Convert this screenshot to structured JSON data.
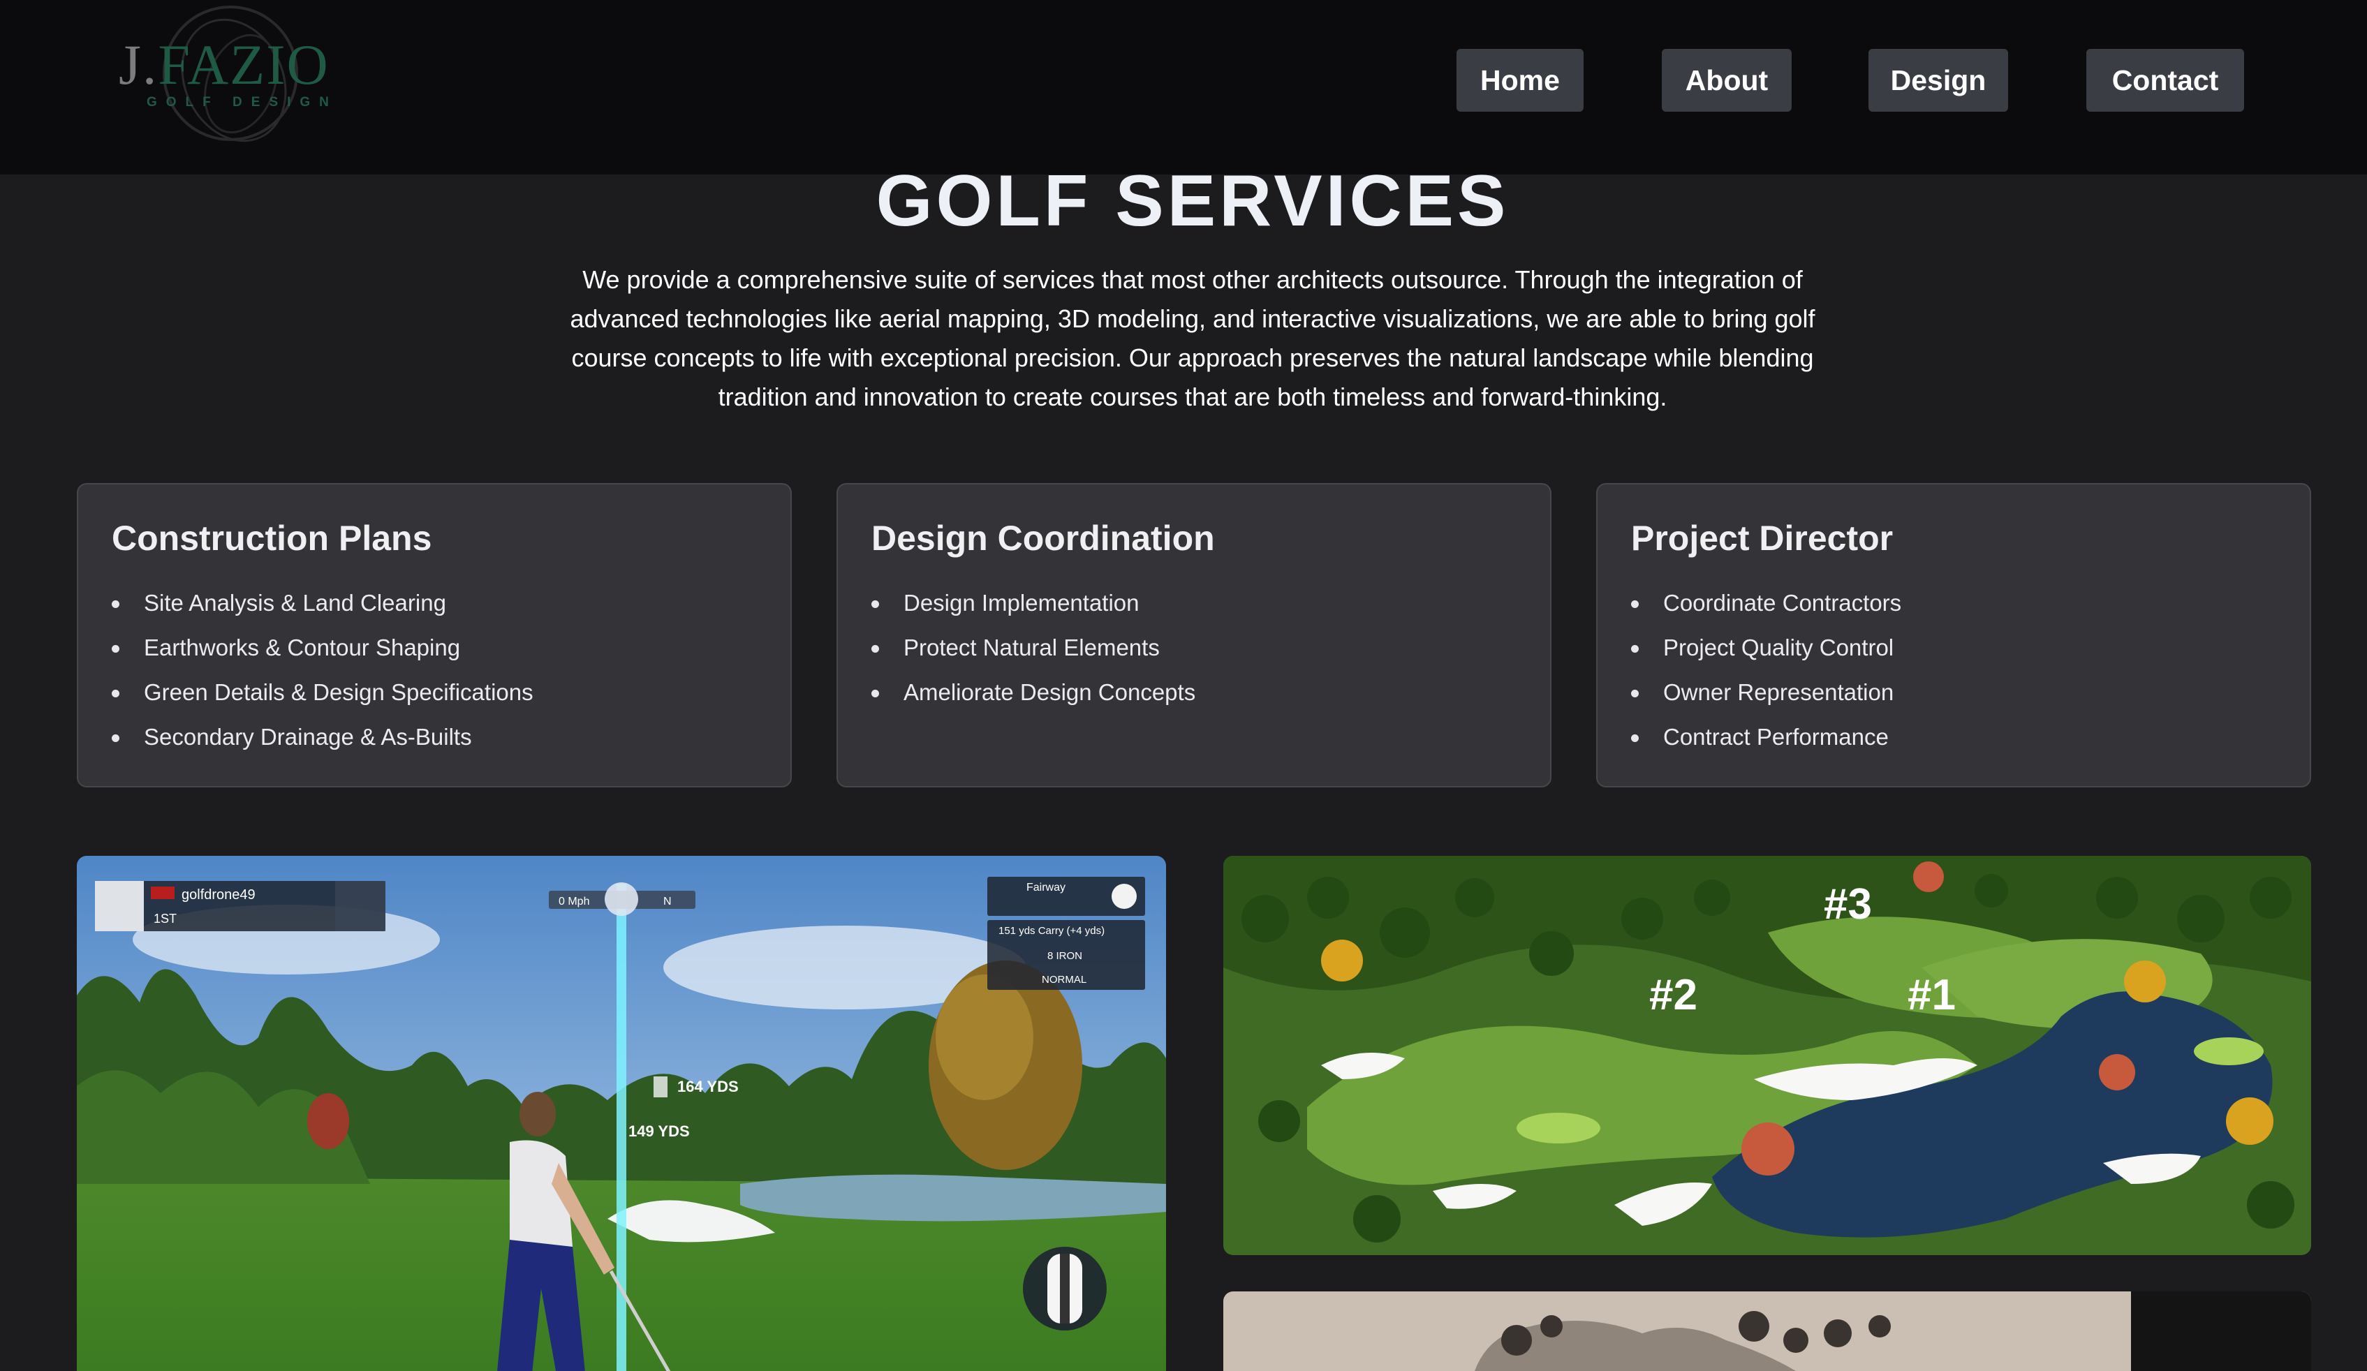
{
  "brand": {
    "logo_initial": "J.",
    "logo_name": "FAZIO",
    "logo_tagline": "GOLF DESIGN"
  },
  "nav": {
    "items": [
      {
        "label": "Home"
      },
      {
        "label": "About"
      },
      {
        "label": "Design"
      },
      {
        "label": "Contact"
      }
    ]
  },
  "intro": {
    "title": "GOLF SERVICES",
    "body": "We provide a comprehensive suite of services that most other architects outsource. Through the integration of advanced technologies like aerial mapping, 3D modeling, and interactive visualizations, we are able to bring golf course concepts to life with exceptional precision. Our approach preserves the natural landscape while blending tradition and innovation to create courses that are both timeless and forward-thinking."
  },
  "services": [
    {
      "title": "Construction Plans",
      "items": [
        "Site Analysis & Land Clearing",
        "Earthworks & Contour Shaping",
        "Green Details & Design Specifications",
        "Secondary Drainage & As-Builts"
      ]
    },
    {
      "title": "Design Coordination",
      "items": [
        "Design Implementation",
        "Protect Natural Elements",
        "Ameliorate Design Concepts"
      ]
    },
    {
      "title": "Project Director",
      "items": [
        "Coordinate Contractors",
        "Project Quality Control",
        "Owner Representation",
        "Contract Performance"
      ]
    }
  ],
  "simulator": {
    "player": "golfdrone49",
    "position": "1ST",
    "wind": "0 Mph",
    "compass": "N",
    "lie": "Fairway",
    "carry": "151 yds Carry (+4 yds)",
    "club": "8 IRON",
    "shot_type": "NORMAL",
    "marker_far": "164 YDS",
    "marker_near": "149 YDS"
  },
  "course_map": {
    "hole_labels": [
      "#3",
      "#2",
      "#1"
    ]
  },
  "colors": {
    "background": "#1c1c1f",
    "header": "#0b0b0d",
    "card": "#343438",
    "nav_button": "#3a3d44",
    "logo_green": "#1f5a44"
  }
}
